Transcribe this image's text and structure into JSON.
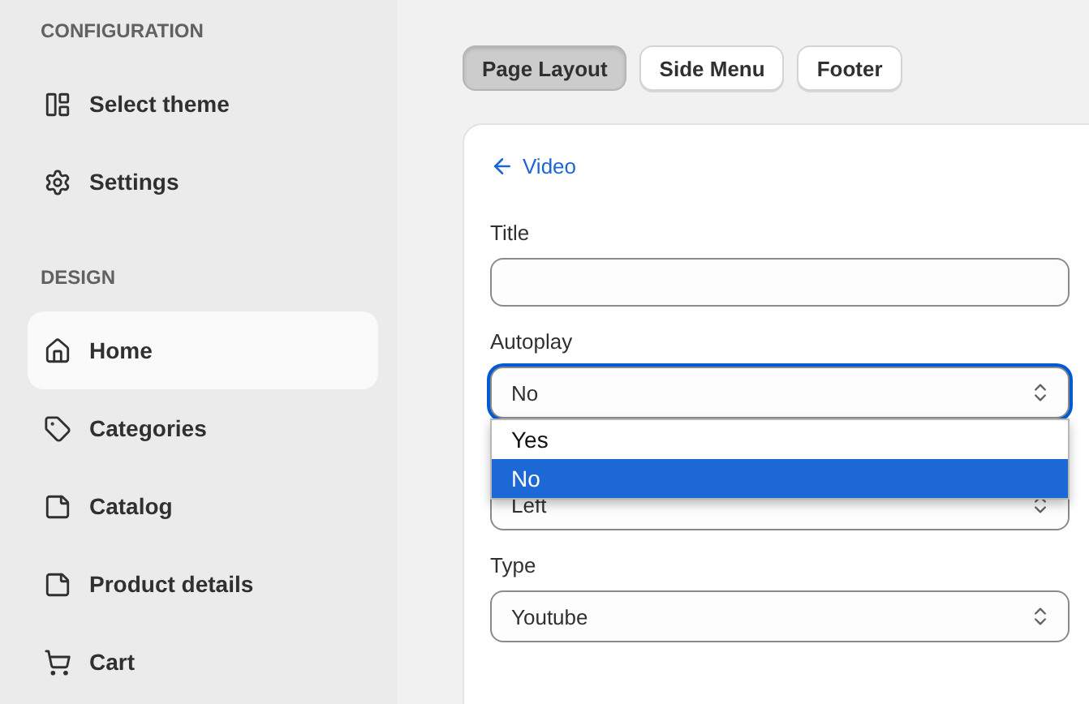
{
  "sidebar": {
    "sections": [
      {
        "heading": "CONFIGURATION",
        "items": [
          {
            "label": "Select theme",
            "selected": false
          },
          {
            "label": "Settings",
            "selected": false
          }
        ]
      },
      {
        "heading": "DESIGN",
        "items": [
          {
            "label": "Home",
            "selected": true
          },
          {
            "label": "Categories",
            "selected": false
          },
          {
            "label": "Catalog",
            "selected": false
          },
          {
            "label": "Product details",
            "selected": false
          },
          {
            "label": "Cart",
            "selected": false
          }
        ]
      }
    ]
  },
  "tabs": [
    {
      "label": "Page Layout",
      "selected": true
    },
    {
      "label": "Side Menu",
      "selected": false
    },
    {
      "label": "Footer",
      "selected": false
    }
  ],
  "panel": {
    "back_link": "Video",
    "fields": [
      {
        "kind": "text",
        "label": "Title"
      },
      {
        "kind": "select",
        "label": "Autoplay",
        "value": "No",
        "open": true,
        "options": [
          {
            "label": "Yes",
            "selected": false
          },
          {
            "label": "No",
            "selected": true
          }
        ]
      },
      {
        "kind": "select",
        "value": "Left",
        "open": false
      },
      {
        "kind": "select",
        "label": "Type",
        "value": "Youtube",
        "open": false
      }
    ]
  }
}
